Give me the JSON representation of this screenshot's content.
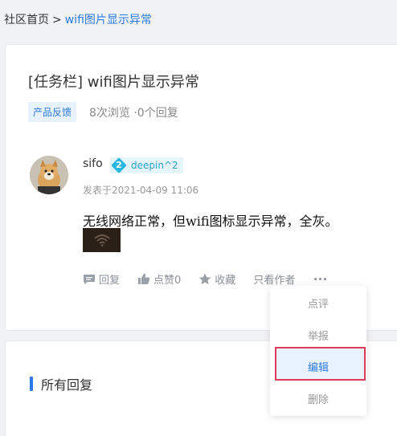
{
  "breadcrumb": {
    "home": "社区首页",
    "separator": ">",
    "current": "wifi图片显示异常"
  },
  "post": {
    "title": "[任务栏] wifi图片显示异常",
    "tag": "产品反馈",
    "stats": "8次浏览 ·0个回复",
    "author": {
      "name": "sifo",
      "level_number": "2",
      "level_label": "deepin^2"
    },
    "time": "发表于2021-04-09 11:06",
    "body": "无线网络正常，但wifi图标显示异常，全灰。",
    "image_icon": "wifi-icon"
  },
  "actions": {
    "reply": "回复",
    "like": "点赞0",
    "favorite": "收藏",
    "only_author": "只看作者"
  },
  "dropdown": {
    "items": [
      "点评",
      "举报",
      "编辑",
      "删除"
    ],
    "selected": "编辑"
  },
  "replies": {
    "title": "所有回复"
  },
  "colors": {
    "accent": "#2c7be5",
    "highlight_border": "#e03a5a"
  }
}
